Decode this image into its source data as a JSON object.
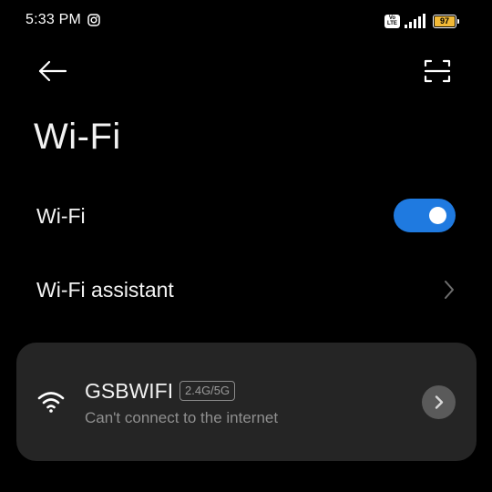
{
  "status_bar": {
    "time": "5:33 PM",
    "notification_icon": "instagram-icon",
    "volte_label": "Vo LTE",
    "signal_icon": "cellular-signal-icon",
    "battery_level": "97",
    "battery_color": "#f2b936"
  },
  "header": {
    "back_icon": "back-arrow-icon",
    "scan_icon": "qr-scan-icon"
  },
  "page": {
    "title": "Wi-Fi"
  },
  "settings": {
    "wifi_toggle": {
      "label": "Wi-Fi",
      "state": "on",
      "accent_color": "#1f7ae0"
    },
    "wifi_assistant": {
      "label": "Wi-Fi assistant",
      "icon": "chevron-right-icon"
    }
  },
  "networks": [
    {
      "ssid": "GSBWIFI",
      "band": "2.4G/5G",
      "status": "Can't connect to the internet",
      "icon": "wifi-signal-icon",
      "action_icon": "chevron-right-circle-icon"
    }
  ]
}
